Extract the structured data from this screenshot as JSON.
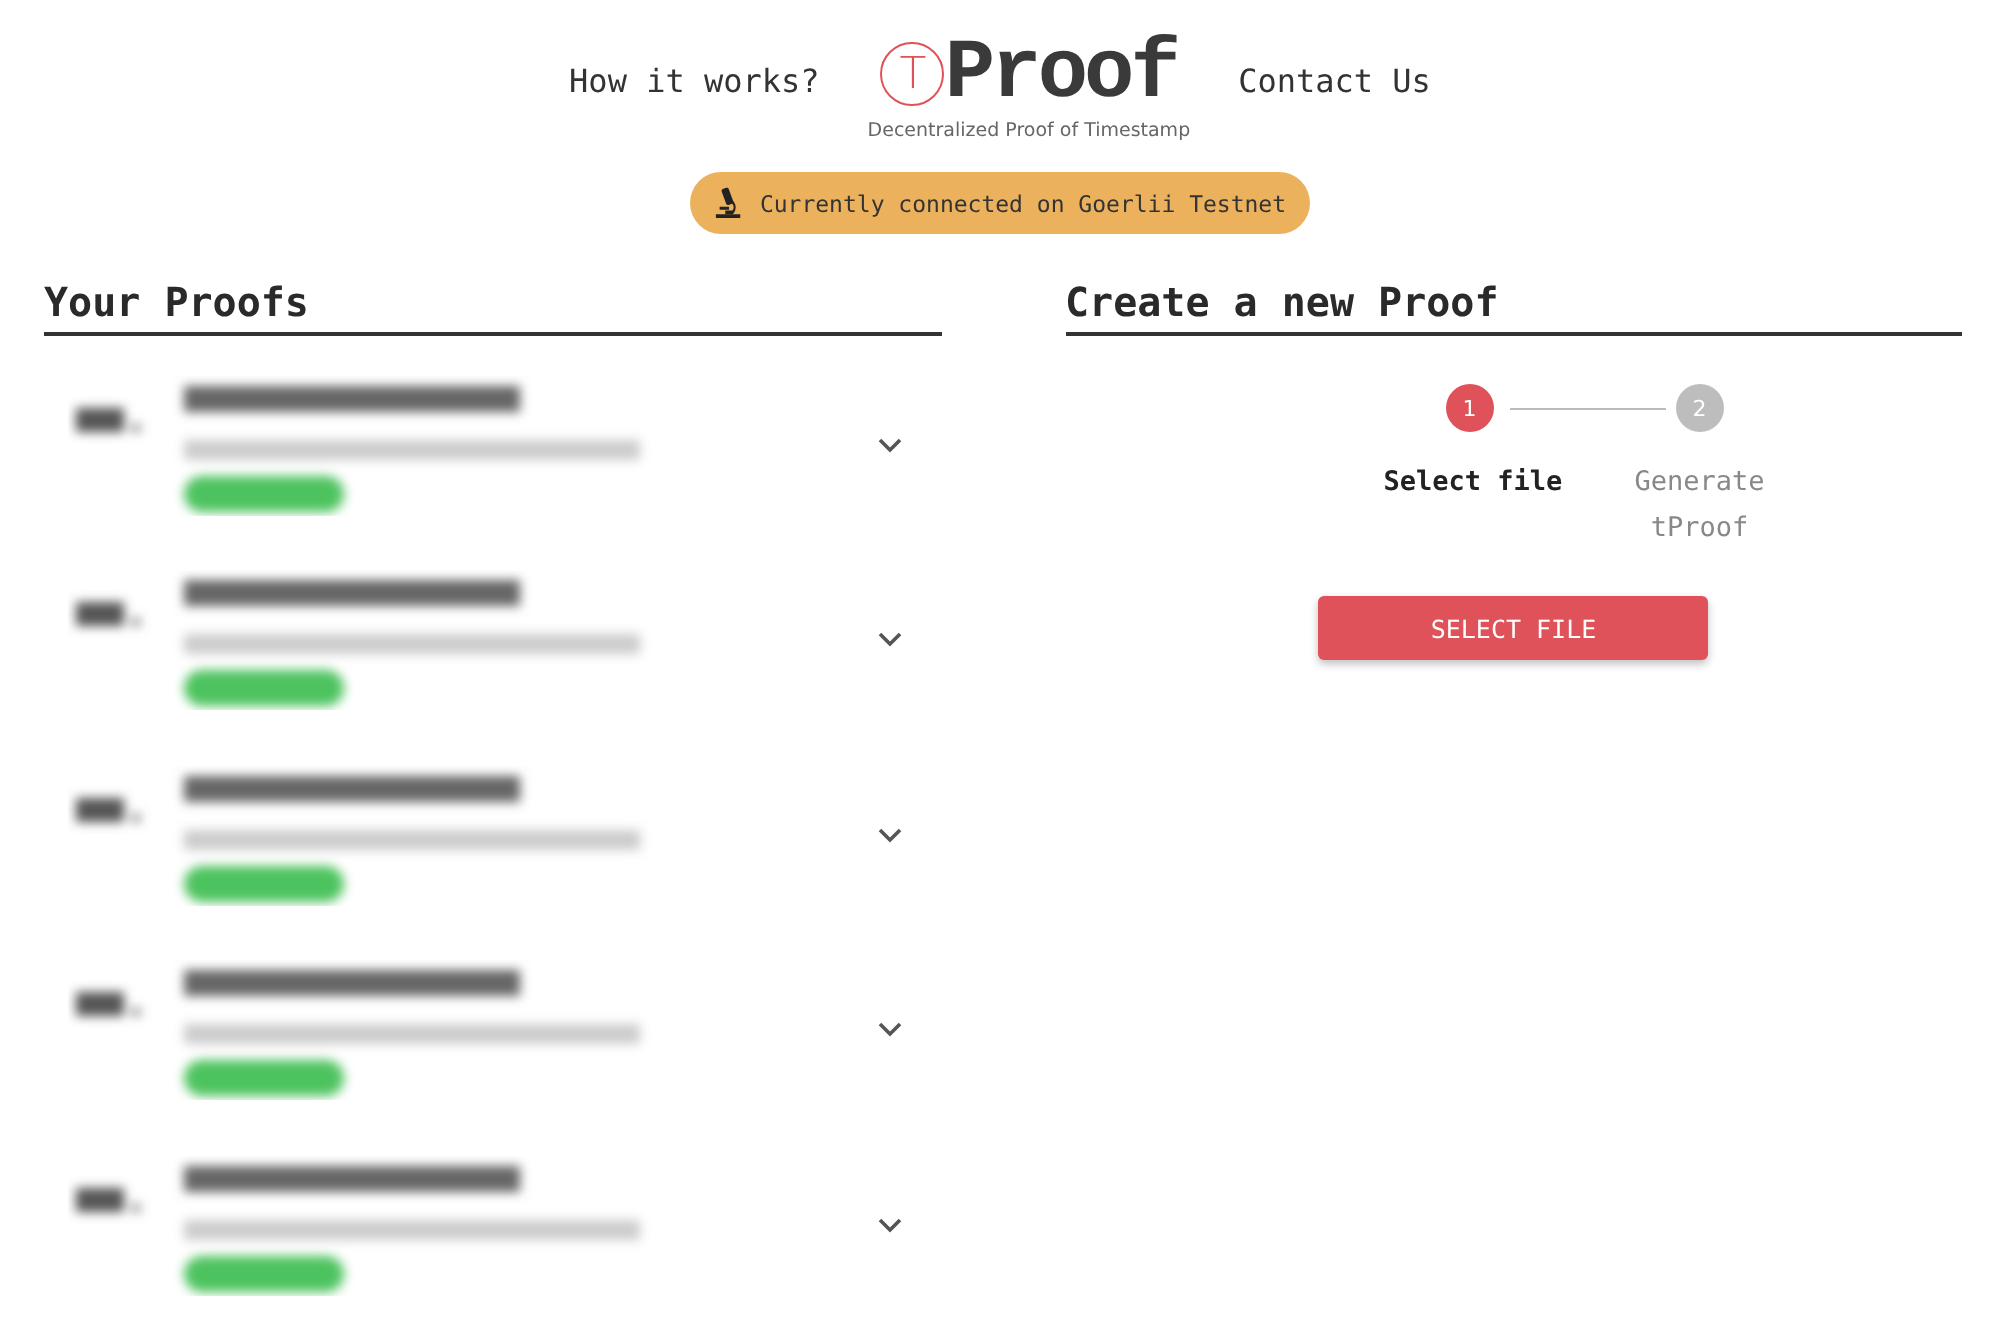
{
  "nav": [
    {
      "label": "How it works?"
    },
    {
      "label": "Contact Us"
    }
  ],
  "logo": {
    "mark": "T",
    "name": "Proof",
    "tagline": "Decentralized Proof of Timestamp"
  },
  "network_badge": {
    "label": "Currently connected on Goerlii Testnet"
  },
  "your_proofs": {
    "title": "Your Proofs",
    "items": [
      {
        "kind": "blurred",
        "expanded": false
      },
      {
        "kind": "blurred",
        "expanded": false
      },
      {
        "kind": "blurred",
        "expanded": false
      },
      {
        "kind": "blurred",
        "expanded": false
      },
      {
        "kind": "blurred",
        "expanded": false
      }
    ]
  },
  "create_proof": {
    "title": "Create a new Proof",
    "steps": [
      {
        "number": "1",
        "label": "Select file",
        "selected": true
      },
      {
        "number": "2",
        "label": "Generate tProof",
        "selected": false
      }
    ],
    "button": "SELECT FILE"
  }
}
